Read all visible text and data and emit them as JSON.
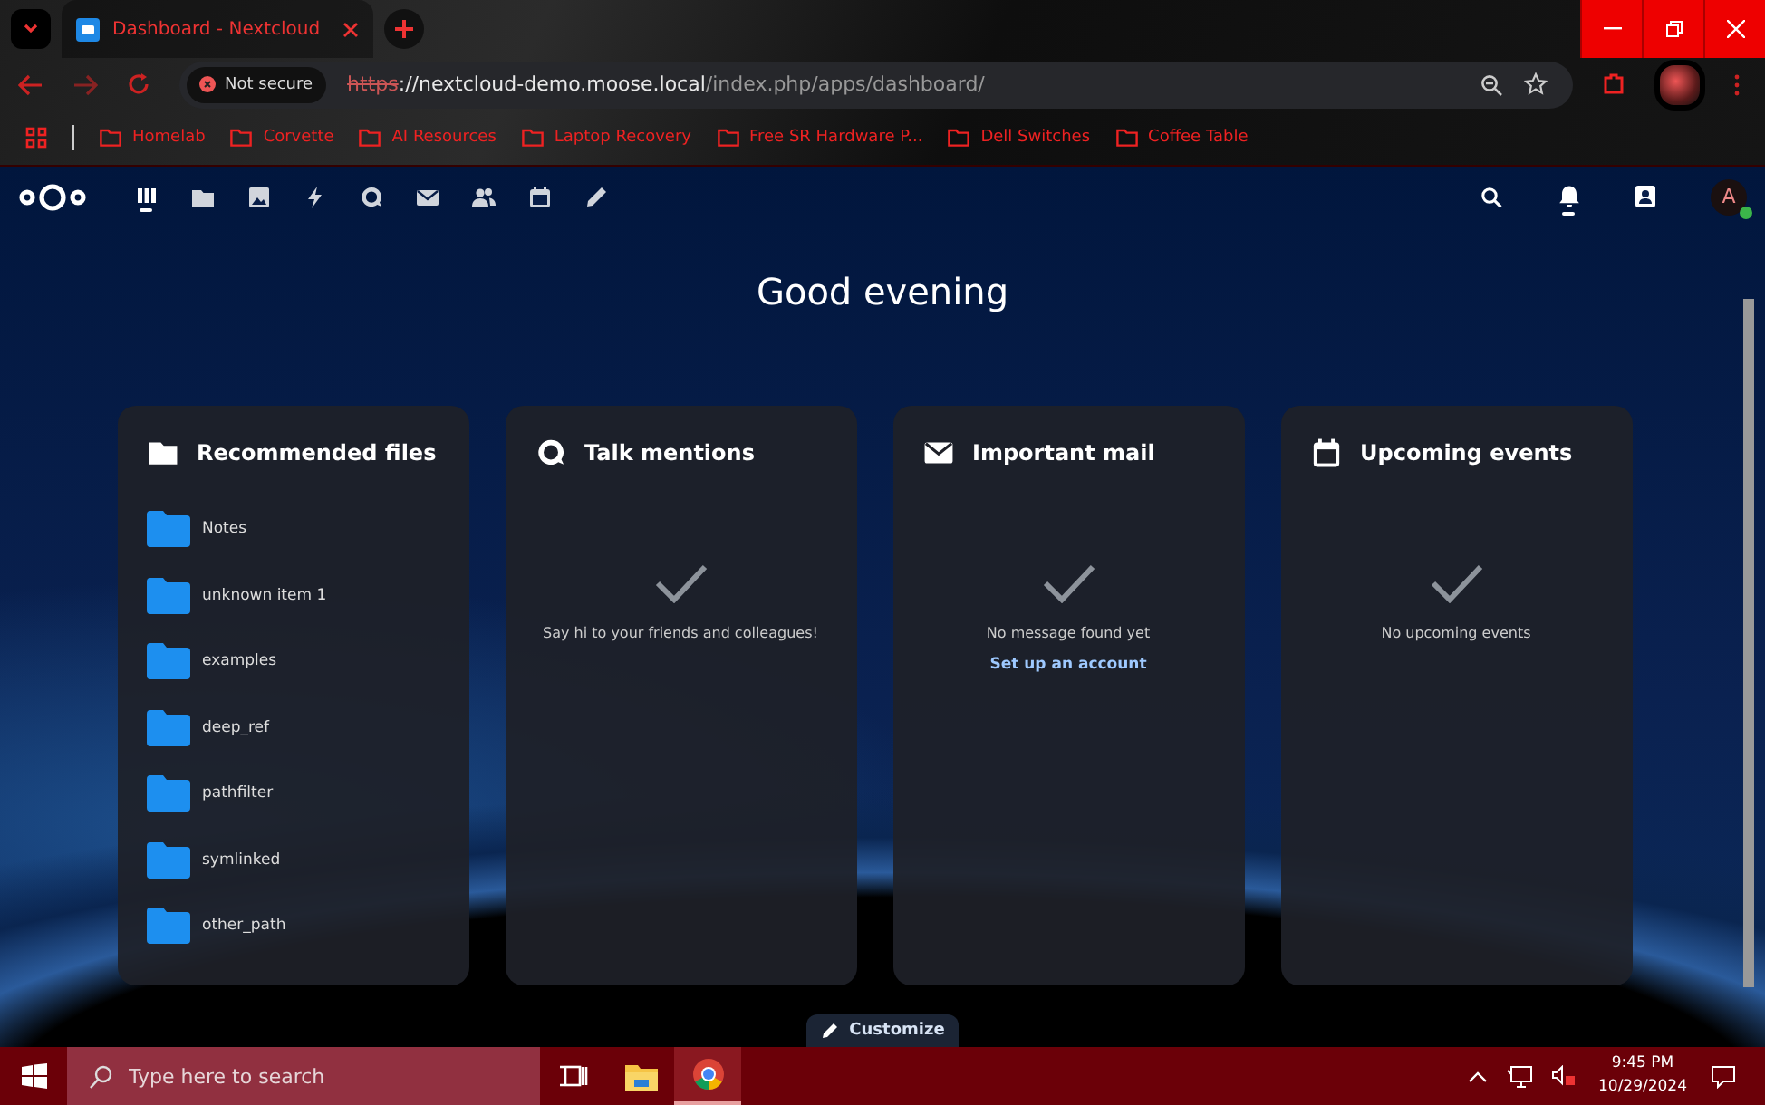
{
  "browser": {
    "tab": {
      "title": "Dashboard - Nextcloud",
      "selected": true
    },
    "address": {
      "security": "Not secure",
      "scheme": "https",
      "host": "://nextcloud-demo.moose.local",
      "path": "/index.php/apps/dashboard/"
    },
    "bookmarks": [
      "Homelab",
      "Corvette",
      "AI Resources",
      "Laptop Recovery",
      "Free SR Hardware P...",
      "Dell Switches",
      "Coffee Table"
    ]
  },
  "nextcloud": {
    "apps": [
      {
        "selected": true
      },
      {
        "selected": false
      },
      {
        "selected": false
      },
      {
        "selected": false
      },
      {
        "selected": false
      },
      {
        "selected": false
      },
      {
        "selected": false
      },
      {
        "selected": false
      },
      {
        "selected": false
      }
    ],
    "notifications_selected": true,
    "avatar": {
      "initial": "A",
      "online": true
    },
    "greeting": "Good evening",
    "widgets": [
      {
        "title": "Recommended files",
        "kind": "files",
        "items": [
          "Notes",
          "unknown item 1",
          "examples",
          "deep_ref",
          "pathfilter",
          "symlinked",
          "other_path"
        ]
      },
      {
        "title": "Talk mentions",
        "kind": "empty",
        "message": "Say hi to your friends and colleagues!"
      },
      {
        "title": "Important mail",
        "kind": "empty",
        "message": "No message found yet",
        "link": "Set up an account"
      },
      {
        "title": "Upcoming events",
        "kind": "empty",
        "message": "No upcoming events"
      }
    ],
    "customize": "Customize"
  },
  "taskbar": {
    "search_placeholder": "Type here to search",
    "apps": [
      {
        "selected": false
      },
      {
        "selected": false
      },
      {
        "selected": true
      }
    ],
    "time": "9:45 PM",
    "date": "10/29/2024"
  }
}
